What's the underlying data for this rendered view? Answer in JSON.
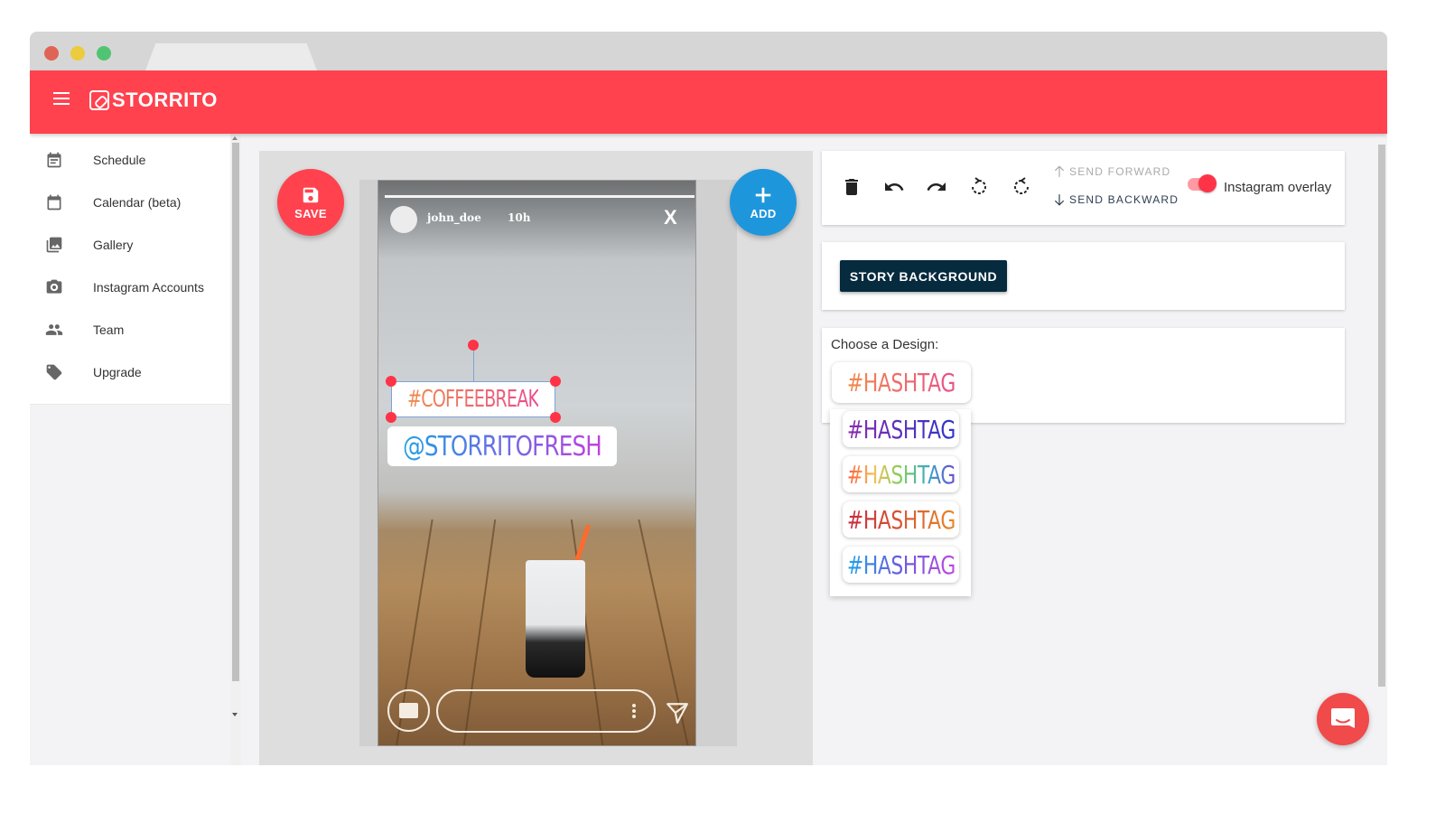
{
  "window": {
    "tab_title": ""
  },
  "app": {
    "brand": "STORRITO",
    "accent": "#ff424e"
  },
  "sidebar": {
    "items": [
      {
        "label": "Schedule",
        "icon": "schedule-icon"
      },
      {
        "label": "Calendar (beta)",
        "icon": "calendar-icon"
      },
      {
        "label": "Gallery",
        "icon": "gallery-icon"
      },
      {
        "label": "Instagram Accounts",
        "icon": "camera-icon"
      },
      {
        "label": "Team",
        "icon": "team-icon"
      },
      {
        "label": "Upgrade",
        "icon": "tag-icon"
      }
    ]
  },
  "editor": {
    "save_label": "SAVE",
    "add_label": "ADD",
    "story": {
      "username": "john_doe",
      "time": "10h",
      "close": "X",
      "sticker_selected": "#COFFEEBREAK",
      "sticker_mention": "@STORRITOFRESH"
    }
  },
  "toolbar": {
    "send_forward": "SEND FORWARD",
    "send_backward": "SEND BACKWARD",
    "overlay_label": "Instagram overlay",
    "overlay_on": true
  },
  "background": {
    "button_label": "STORY BACKGROUND"
  },
  "design": {
    "title": "Choose a Design:",
    "selected": {
      "text": "#HASHTAG",
      "gradient": [
        "#f08a4b",
        "#e9508a"
      ]
    },
    "options": [
      {
        "text": "#HASHTAG",
        "gradient": [
          "#8a2bb0",
          "#2c36c8"
        ]
      },
      {
        "text": "#HASHTAG",
        "gradient": [
          "#ff5b3a",
          "#f3c05a",
          "#7fcf5b",
          "#3aa7c9",
          "#6a4bd2"
        ]
      },
      {
        "text": "#HASHTAG",
        "gradient": [
          "#c8283c",
          "#e8872a"
        ]
      },
      {
        "text": "#HASHTAG",
        "gradient": [
          "#1fa4e6",
          "#6a5ae0",
          "#c04ae0"
        ]
      }
    ]
  }
}
